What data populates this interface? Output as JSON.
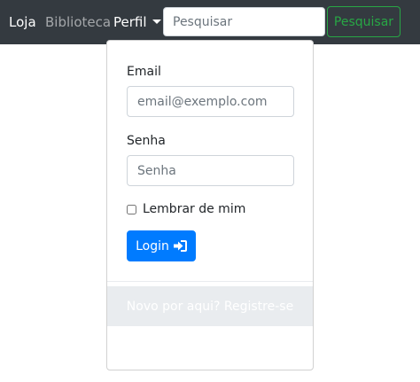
{
  "navbar": {
    "brand": "Loja",
    "links": [
      "Biblioteca",
      "Perfil"
    ],
    "search": {
      "placeholder": "Pesquisar",
      "button_label": "Pesquisar"
    }
  },
  "login_form": {
    "email_label": "Email",
    "email_placeholder": "email@exemplo.com",
    "password_label": "Senha",
    "password_placeholder": "Senha",
    "remember_label": "Lembrar de mim",
    "login_label": "Login",
    "login_icon": "sign-in-icon",
    "register_text": "Novo por aqui? Registre-se"
  },
  "colors": {
    "navbar_bg": "#343a40",
    "primary": "#007bff",
    "success": "#28a745",
    "muted_bg": "#e9ecef"
  }
}
